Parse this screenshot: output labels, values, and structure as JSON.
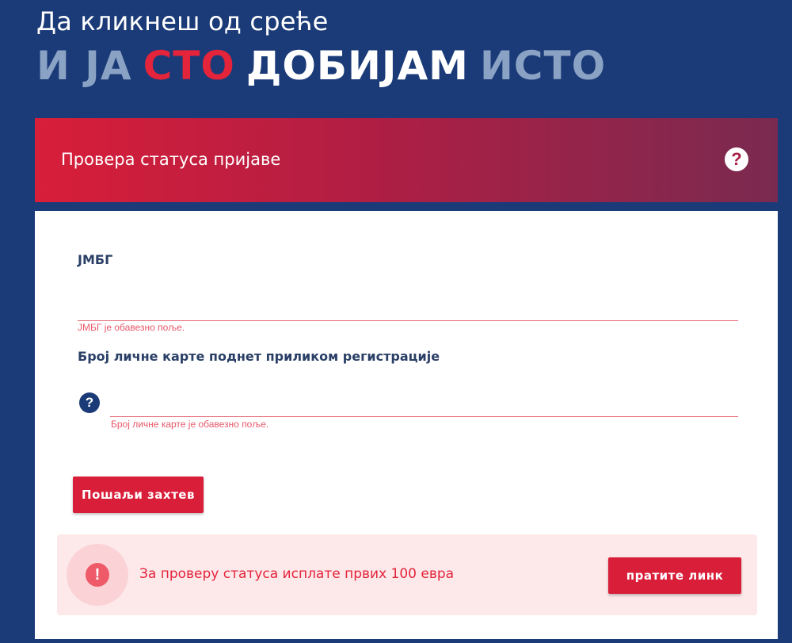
{
  "hero": {
    "subtitle": "Да кликнеш од среће",
    "title_words": [
      "И ЈА",
      "СТО",
      "ДОБИЈАМ",
      "ИСТО"
    ]
  },
  "card": {
    "title": "Провера статуса пријаве",
    "help_icon": "?"
  },
  "form": {
    "jmbg": {
      "label": "ЈМБГ",
      "value": "",
      "error": "ЈМБГ је обавезно поље."
    },
    "id_card": {
      "label": "Број личне карте поднет приликом регистрације",
      "value": "",
      "help_icon": "?",
      "error": "Број личне карте је обавезно поље."
    },
    "submit_label": "Пошаљи захтев"
  },
  "info": {
    "icon": "!",
    "text": "За проверу статуса исплате првих 100 евра",
    "link_label": "пратите линк"
  },
  "colors": {
    "background": "#1b3b78",
    "accent_red": "#d81e39",
    "title_muted": "#8aa2c4",
    "error": "#e8586a",
    "info_bg": "#fde9ea"
  }
}
